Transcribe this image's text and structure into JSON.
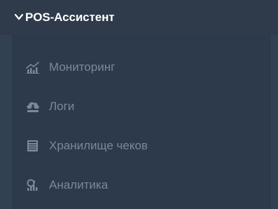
{
  "colors": {
    "background": "#324152",
    "header_bg": "#2f3b4b",
    "items_bg": "#2c3a4c",
    "header_text": "#ffffff",
    "item_text": "#7d8898",
    "icon": "#7d8898"
  },
  "group": {
    "title": "POS-Ассистент",
    "icon": "chevron-down-icon",
    "expanded": true
  },
  "items": [
    {
      "label": "Мониторинг",
      "icon": "monitoring-chart-icon"
    },
    {
      "label": "Логи",
      "icon": "cloud-download-icon"
    },
    {
      "label": "Хранилище чеков",
      "icon": "receipt-storage-icon"
    },
    {
      "label": "Аналитика",
      "icon": "analytics-icon"
    }
  ]
}
